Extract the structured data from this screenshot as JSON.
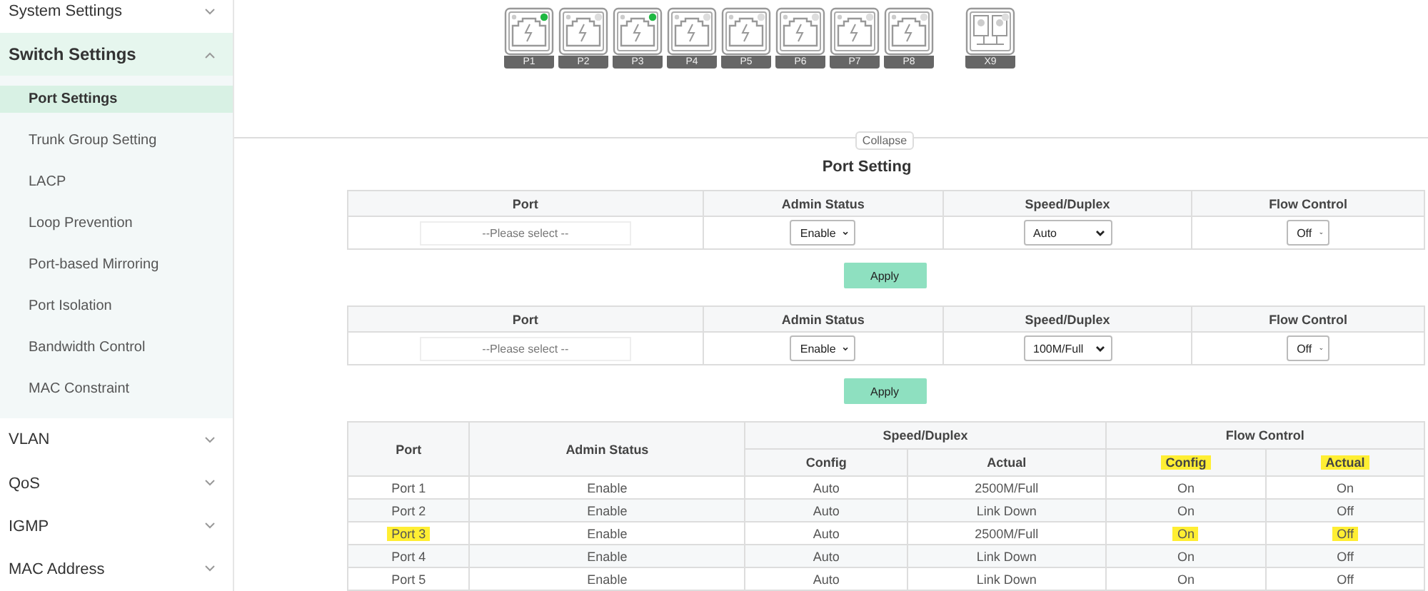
{
  "sidebar": {
    "items": [
      {
        "label": "System Settings",
        "expanded": false
      },
      {
        "label": "Switch Settings",
        "expanded": true,
        "children": [
          {
            "label": "Port Settings",
            "selected": true
          },
          {
            "label": "Trunk Group Setting",
            "selected": false
          },
          {
            "label": "LACP",
            "selected": false
          },
          {
            "label": "Loop Prevention",
            "selected": false
          },
          {
            "label": "Port-based Mirroring",
            "selected": false
          },
          {
            "label": "Port Isolation",
            "selected": false
          },
          {
            "label": "Bandwidth Control",
            "selected": false
          },
          {
            "label": "MAC Constraint",
            "selected": false
          }
        ]
      },
      {
        "label": "VLAN",
        "expanded": false
      },
      {
        "label": "QoS",
        "expanded": false
      },
      {
        "label": "IGMP",
        "expanded": false
      },
      {
        "label": "MAC Address",
        "expanded": false
      }
    ]
  },
  "ports": [
    {
      "label": "P1",
      "kind": "rj45",
      "link": true
    },
    {
      "label": "P2",
      "kind": "rj45",
      "link": false
    },
    {
      "label": "P3",
      "kind": "rj45",
      "link": true
    },
    {
      "label": "P4",
      "kind": "rj45",
      "link": false
    },
    {
      "label": "P5",
      "kind": "rj45",
      "link": false
    },
    {
      "label": "P6",
      "kind": "rj45",
      "link": false
    },
    {
      "label": "P7",
      "kind": "rj45",
      "link": false
    },
    {
      "label": "P8",
      "kind": "rj45",
      "link": false
    },
    {
      "label": "X9",
      "kind": "sfp",
      "link": false
    }
  ],
  "collapse_label": "Collapse",
  "title": "Port Setting",
  "forms": [
    {
      "columns": [
        "Port",
        "Admin Status",
        "Speed/Duplex",
        "Flow Control"
      ],
      "port_placeholder": "--Please select --",
      "admin_status": "Enable",
      "speed_duplex": "Auto",
      "flow_control": "Off",
      "button": "Apply"
    },
    {
      "columns": [
        "Port",
        "Admin Status",
        "Speed/Duplex",
        "Flow Control"
      ],
      "port_placeholder": "--Please select --",
      "admin_status": "Enable",
      "speed_duplex": "100M/Full",
      "flow_control": "Off",
      "button": "Apply"
    }
  ],
  "status_table": {
    "groups": [
      {
        "label": "Port"
      },
      {
        "label": "Admin Status"
      },
      {
        "label": "Speed/Duplex",
        "sub": [
          {
            "label": "Config",
            "marked": false
          },
          {
            "label": "Actual",
            "marked": false
          }
        ]
      },
      {
        "label": "Flow Control",
        "sub": [
          {
            "label": "Config",
            "marked": true
          },
          {
            "label": "Actual",
            "marked": true
          }
        ]
      }
    ],
    "rows": [
      {
        "cells": [
          "Port 1",
          "Enable",
          "Auto",
          "2500M/Full",
          "On",
          "On"
        ],
        "marked": [
          false,
          false,
          false,
          false,
          false,
          false
        ]
      },
      {
        "cells": [
          "Port 2",
          "Enable",
          "Auto",
          "Link Down",
          "On",
          "Off"
        ],
        "marked": [
          false,
          false,
          false,
          false,
          false,
          false
        ]
      },
      {
        "cells": [
          "Port 3",
          "Enable",
          "Auto",
          "2500M/Full",
          "On",
          "Off"
        ],
        "marked": [
          true,
          false,
          false,
          false,
          true,
          true
        ]
      },
      {
        "cells": [
          "Port 4",
          "Enable",
          "Auto",
          "Link Down",
          "On",
          "Off"
        ],
        "marked": [
          false,
          false,
          false,
          false,
          false,
          false
        ]
      },
      {
        "cells": [
          "Port 5",
          "Enable",
          "Auto",
          "Link Down",
          "On",
          "Off"
        ],
        "marked": [
          false,
          false,
          false,
          false,
          false,
          false
        ]
      }
    ]
  }
}
